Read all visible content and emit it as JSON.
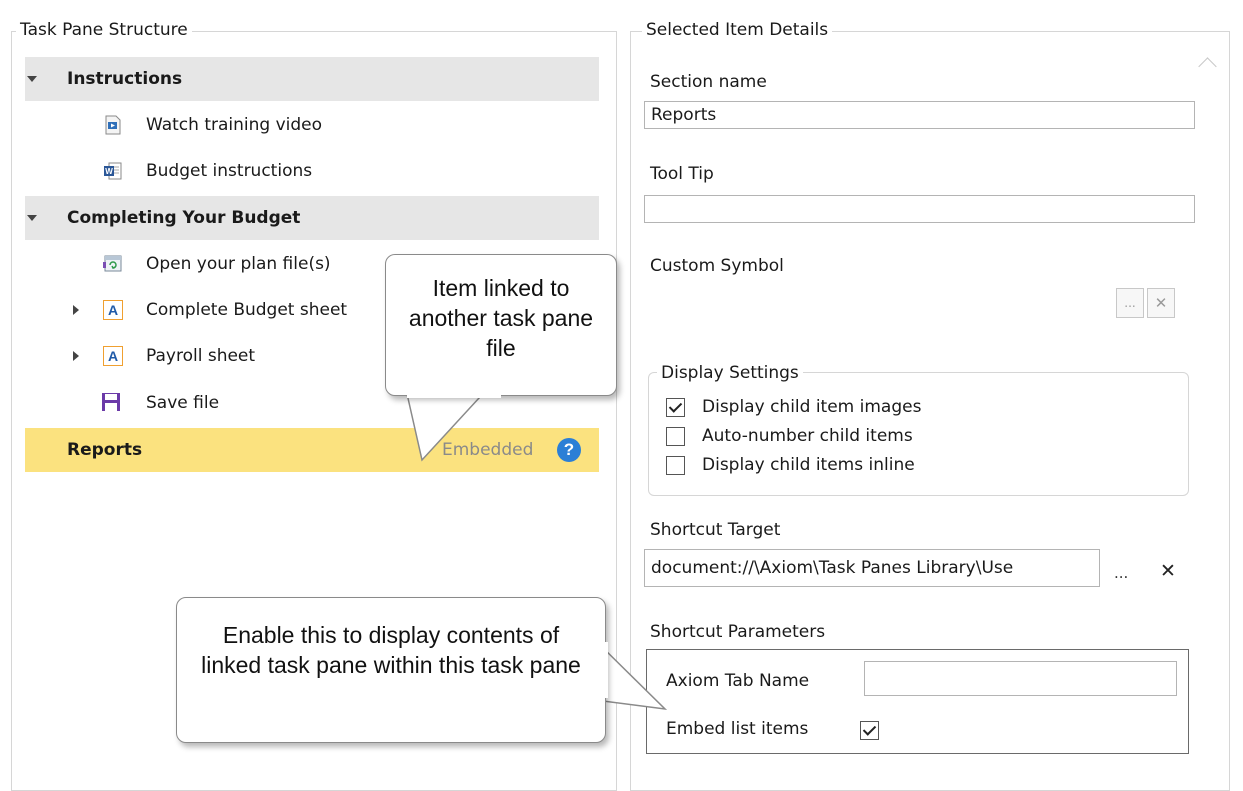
{
  "left_panel": {
    "title": "Task Pane Structure",
    "tree": {
      "instructions": {
        "label": "Instructions",
        "children": [
          {
            "label": "Watch training video",
            "icon": "video-icon"
          },
          {
            "label": "Budget instructions",
            "icon": "word-doc-icon"
          }
        ]
      },
      "completing": {
        "label": "Completing Your Budget",
        "children": [
          {
            "label": "Open your plan file(s)",
            "icon": "open-plan-icon"
          },
          {
            "label": "Complete Budget sheet",
            "icon": "axiom-sheet-icon"
          },
          {
            "label": "Payroll sheet",
            "icon": "axiom-sheet-icon"
          },
          {
            "label": "Save file",
            "icon": "save-icon"
          }
        ]
      },
      "reports": {
        "label": "Reports",
        "badge": "Embedded"
      }
    }
  },
  "right_panel": {
    "title": "Selected Item Details",
    "section_name": {
      "label": "Section name",
      "value": "Reports"
    },
    "tool_tip": {
      "label": "Tool Tip",
      "value": ""
    },
    "custom_symbol": {
      "label": "Custom Symbol",
      "browse_label": "...",
      "clear_label": "✕"
    },
    "display_settings": {
      "title": "Display Settings",
      "options": [
        {
          "label": "Display child item images",
          "checked": true
        },
        {
          "label": "Auto-number child items",
          "checked": false
        },
        {
          "label": "Display child items inline",
          "checked": false
        }
      ]
    },
    "shortcut_target": {
      "label": "Shortcut Target",
      "value": "document://\\Axiom\\Task Panes Library\\Use",
      "browse_label": "...",
      "clear_label": "✕"
    },
    "shortcut_parameters": {
      "title": "Shortcut Parameters",
      "tab_name_label": "Axiom Tab Name",
      "tab_name_value": "",
      "embed_label": "Embed list items",
      "embed_checked": true
    }
  },
  "callouts": {
    "linked": "Item linked to another task pane file",
    "embed": "Enable this to display contents of linked task pane within this task pane"
  },
  "colors": {
    "highlight": "#fbe27f",
    "section_bg": "#e6e6e6",
    "help_icon": "#2b7fd6"
  }
}
